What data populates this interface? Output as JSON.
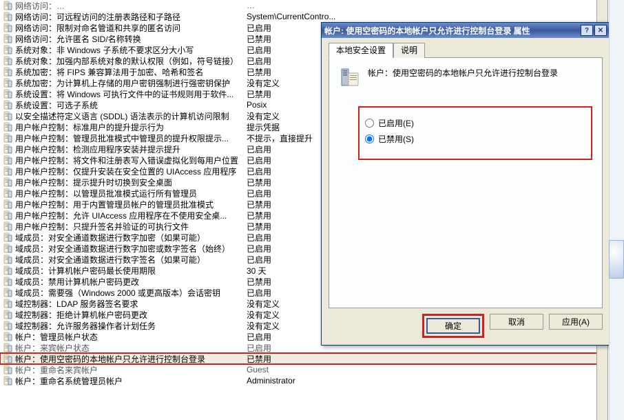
{
  "list": [
    {
      "name": "网络访问：…",
      "value": "…",
      "muted": true
    },
    {
      "name": "网络访问：可远程访问的注册表路径和子路径",
      "value": "System\\CurrentContro..."
    },
    {
      "name": "网络访问：限制对命名管道和共享的匿名访问",
      "value": "已启用"
    },
    {
      "name": "网络访问：允许匿名 SID/名称转换",
      "value": "已禁用"
    },
    {
      "name": "系统对象：非 Windows 子系统不要求区分大小写",
      "value": "已启用"
    },
    {
      "name": "系统对象：加强内部系统对象的默认权限（例如，符号链接）",
      "value": "已启用"
    },
    {
      "name": "系统加密：将 FIPS 兼容算法用于加密、哈希和签名",
      "value": "已禁用"
    },
    {
      "name": "系统加密：为计算机上存储的用户密钥强制进行强密钥保护",
      "value": "没有定义"
    },
    {
      "name": "系统设置：将 Windows 可执行文件中的证书规则用于软件...",
      "value": "已禁用"
    },
    {
      "name": "系统设置：可选子系统",
      "value": "Posix"
    },
    {
      "name": "以安全描述符定义语言 (SDDL) 语法表示的计算机访问限制",
      "value": "没有定义"
    },
    {
      "name": "用户帐户控制：标准用户的提升提示行为",
      "value": "提示凭据"
    },
    {
      "name": "用户帐户控制：管理员批准模式中管理员的提升权限提示...",
      "value": "不提示，直接提升"
    },
    {
      "name": "用户帐户控制：检测应用程序安装并提示提升",
      "value": "已启用"
    },
    {
      "name": "用户帐户控制：将文件和注册表写入错误虚拟化到每用户位置",
      "value": "已启用"
    },
    {
      "name": "用户帐户控制：仅提升安装在安全位置的 UIAccess 应用程序",
      "value": "已启用"
    },
    {
      "name": "用户帐户控制：提示提升时切换到安全桌面",
      "value": "已禁用"
    },
    {
      "name": "用户帐户控制：以管理员批准模式运行所有管理员",
      "value": "已启用"
    },
    {
      "name": "用户帐户控制：用于内置管理员帐户的管理员批准模式",
      "value": "已禁用"
    },
    {
      "name": "用户帐户控制：允许 UIAccess 应用程序在不使用安全桌...",
      "value": "已禁用"
    },
    {
      "name": "用户帐户控制：只提升签名并验证的可执行文件",
      "value": "已禁用"
    },
    {
      "name": "域成员：对安全通道数据进行数字加密（如果可能）",
      "value": "已启用"
    },
    {
      "name": "域成员：对安全通道数据进行数字加密或数字签名（始终）",
      "value": "已启用"
    },
    {
      "name": "域成员：对安全通道数据进行数字签名（如果可能）",
      "value": "已启用"
    },
    {
      "name": "域成员：计算机帐户密码最长使用期限",
      "value": "30 天"
    },
    {
      "name": "域成员：禁用计算机帐户密码更改",
      "value": "已禁用"
    },
    {
      "name": "域成员：需要强（Windows 2000 或更高版本）会话密钥",
      "value": "已启用"
    },
    {
      "name": "域控制器：LDAP 服务器签名要求",
      "value": "没有定义"
    },
    {
      "name": "域控制器：拒绝计算机帐户密码更改",
      "value": "没有定义"
    },
    {
      "name": "域控制器：允许服务器操作者计划任务",
      "value": "没有定义"
    },
    {
      "name": "帐户：管理员帐户状态",
      "value": "已启用"
    },
    {
      "name": "帐户：来宾帐户状态",
      "value": "已启用",
      "muted": true
    },
    {
      "name": "帐户：使用空密码的本地帐户只允许进行控制台登录",
      "value": "已禁用",
      "highlighted": true
    },
    {
      "name": "帐户：重命名来宾帐户",
      "value": "Guest",
      "muted": true
    },
    {
      "name": "帐户：重命名系统管理员帐户",
      "value": "Administrator"
    }
  ],
  "dialog": {
    "title": "帐户: 使用空密码的本地帐户只允许进行控制台登录 属性",
    "tabs": {
      "t1": "本地安全设置",
      "t2": "说明"
    },
    "policy_title": "帐户：使用空密码的本地帐户只允许进行控制台登录",
    "radio_enabled": "已启用(E)",
    "radio_disabled": "已禁用(S)",
    "buttons": {
      "ok": "确定",
      "cancel": "取消",
      "apply": "应用(A)"
    }
  }
}
